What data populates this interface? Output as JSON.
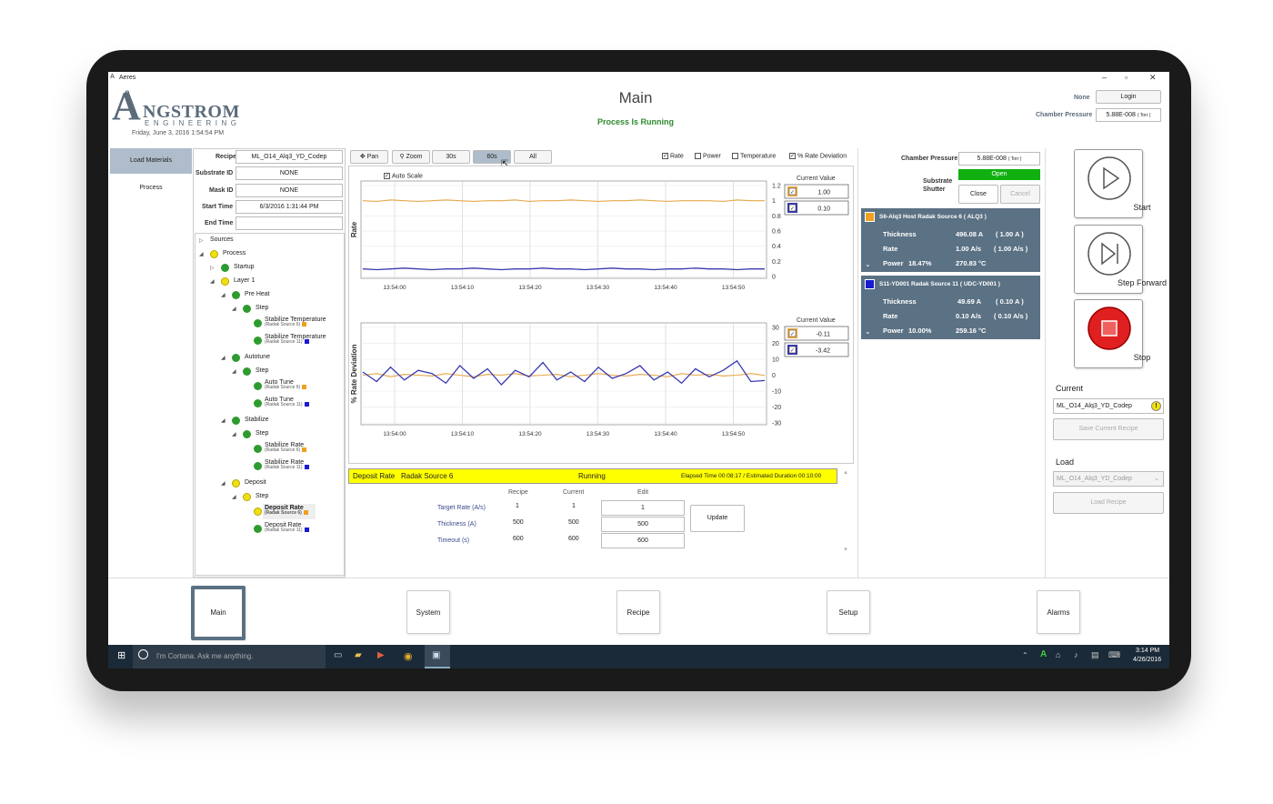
{
  "window": {
    "title": "Aeres"
  },
  "logo": {
    "initial": "A",
    "name": "NGSTROM",
    "sub": "ENGINEERING",
    "accent": "e"
  },
  "date_text": "Friday, June 3, 2016 1:54:54 PM",
  "header": {
    "title": "Main",
    "status": "Process Is Running",
    "user": "None",
    "login_label": "Login",
    "chamber_pressure_label": "Chamber Pressure",
    "chamber_pressure_value": "5.88E-008",
    "chamber_pressure_unit": "( Torr )"
  },
  "left_tabs": [
    "Load Materials",
    "Process"
  ],
  "info": {
    "recipe_label": "Recipe",
    "recipe_value": "ML_O14_Alq3_YD_Codep",
    "substrate_label": "Substrate ID",
    "substrate_value": "NONE",
    "mask_label": "Mask ID",
    "mask_value": "NONE",
    "start_label": "Start Time",
    "start_value": "6/3/2016 1:31:44 PM",
    "end_label": "End Time",
    "end_value": ""
  },
  "tree": {
    "sources": "Sources",
    "process": "Process",
    "startup": "Startup",
    "layer1": "Layer 1",
    "preheat": "Pre Heat",
    "step": "Step",
    "stab_temp": "Stabilize Temperature",
    "src6": "(Radak Source 6)",
    "src11": "(Radak Source 11)",
    "autotune": "Autotune",
    "auto_tune": "Auto Tune",
    "stabilize": "Stabilize",
    "stab_rate": "Stabilize Rate",
    "deposit": "Deposit",
    "dep_rate": "Deposit Rate"
  },
  "chart_toolbar": {
    "pan": "Pan",
    "zoom": "Zoom",
    "t30": "30s",
    "t60": "60s",
    "all": "All",
    "rate": "Rate",
    "power": "Power",
    "temperature": "Temperature",
    "rate_dev": "% Rate Deviation",
    "auto_scale": "Auto Scale"
  },
  "chart_data": [
    {
      "type": "line",
      "ylabel": "Rate",
      "ylim": [
        0,
        1.2
      ],
      "yticks": [
        "1.2",
        "1",
        "0.8",
        "0.6",
        "0.4",
        "0.2",
        "0"
      ],
      "xticks": [
        "13:54:00",
        "13:54:10",
        "13:54:20",
        "13:54:30",
        "13:54:40",
        "13:54:50"
      ],
      "legend_title": "Current Value",
      "series": [
        {
          "color": "#e8a94a",
          "current": "1.00",
          "values": [
            1.0,
            0.99,
            1.01,
            1.0,
            0.99,
            1.0,
            1.01,
            1.0,
            0.99,
            1.0,
            1.0,
            1.01,
            0.99,
            1.0,
            1.0,
            1.01,
            1.0,
            0.99,
            1.0,
            1.0,
            1.01,
            1.0,
            0.99,
            1.0,
            1.0,
            1.0,
            0.99,
            1.01,
            1.0,
            1.0
          ]
        },
        {
          "color": "#3a3ab0",
          "current": "0.10",
          "values": [
            0.1,
            0.09,
            0.1,
            0.11,
            0.1,
            0.09,
            0.1,
            0.1,
            0.11,
            0.1,
            0.09,
            0.1,
            0.1,
            0.11,
            0.1,
            0.1,
            0.09,
            0.1,
            0.11,
            0.1,
            0.1,
            0.09,
            0.1,
            0.1,
            0.11,
            0.1,
            0.1,
            0.09,
            0.1,
            0.1
          ]
        }
      ]
    },
    {
      "type": "line",
      "ylabel": "% Rate Deviation",
      "ylim": [
        -30,
        30
      ],
      "yticks": [
        "30",
        "20",
        "10",
        "0",
        "-10",
        "-20",
        "-30"
      ],
      "xticks": [
        "13:54:00",
        "13:54:10",
        "13:54:20",
        "13:54:30",
        "13:54:40",
        "13:54:50"
      ],
      "legend_title": "Current Value",
      "series": [
        {
          "color": "#e8a94a",
          "current": "-0.11",
          "values": [
            0,
            1,
            -1,
            0.5,
            0,
            -0.5,
            1,
            0,
            -1,
            0.5,
            0,
            1,
            -0.5,
            0,
            0.5,
            -1,
            0,
            1,
            0,
            -0.5,
            0.5,
            0,
            -1,
            1,
            0,
            0.5,
            -0.5,
            0,
            1,
            -0.1
          ]
        },
        {
          "color": "#3a3ab0",
          "current": "-3.42",
          "values": [
            2,
            -4,
            5,
            -3,
            3,
            1,
            -5,
            6,
            -2,
            4,
            -6,
            3,
            -1,
            8,
            -3,
            2,
            -4,
            5,
            -2,
            1,
            6,
            -3,
            2,
            -5,
            4,
            -1,
            3,
            9,
            -4,
            -3.4
          ]
        }
      ]
    }
  ],
  "step_bar": {
    "name": "Deposit Rate",
    "source": "Radak Source 6",
    "state": "Running",
    "elapsed": "Elapsed Time 00:08:17 / Estimated Duration 00:10:00"
  },
  "params": {
    "col_recipe": "Recipe",
    "col_current": "Current",
    "col_edit": "Edit",
    "rows": [
      {
        "label": "Target Rate (A/s)",
        "recipe": "1",
        "current": "1",
        "edit": "1"
      },
      {
        "label": "Thickness (A)",
        "recipe": "500",
        "current": "500",
        "edit": "500"
      },
      {
        "label": "Timeout (s)",
        "recipe": "600",
        "current": "600",
        "edit": "600"
      }
    ],
    "update": "Update"
  },
  "right": {
    "pressure_label": "Chamber Pressure",
    "pressure_value": "5.88E-008",
    "pressure_unit": "( Torr )",
    "shutter_label1": "Substrate",
    "shutter_label2": "Shutter",
    "shutter_state": "Open",
    "close": "Close",
    "cancel": "Cancel",
    "src1": {
      "title": "S6-Alq3 Host Radak Source 6 ( ALQ3 )",
      "color": "#f0a020",
      "thickness_label": "Thickness",
      "thickness": "496.08 A",
      "thickness_set": "( 1.00 A )",
      "rate_label": "Rate",
      "rate": "1.00 A/s",
      "rate_set": "( 1.00 A/s )",
      "power_label": "Power",
      "power": "18.47%",
      "temp": "270.83 °C"
    },
    "src2": {
      "title": "S11-YD001 Radak Source 11 ( UDC-YD001 )",
      "color": "#1a1ad0",
      "thickness_label": "Thickness",
      "thickness": "49.69 A",
      "thickness_set": "( 0.10 A )",
      "rate_label": "Rate",
      "rate": "0.10 A/s",
      "rate_set": "( 0.10 A/s )",
      "power_label": "Power",
      "power": "10.00%",
      "temp": "259.16 °C"
    }
  },
  "controls": {
    "start": "Start",
    "step_forward": "Step Forward",
    "stop": "Stop",
    "current_label": "Current",
    "current_recipe": "ML_O14_Alq3_YD_Codep",
    "save": "Save Current Recipe",
    "load_label": "Load",
    "load_recipe": "ML_O14_Alq3_YD_Codep",
    "load_btn": "Load Recipe"
  },
  "nav": [
    "Main",
    "System",
    "Recipe",
    "Setup",
    "Alarms"
  ],
  "taskbar": {
    "search": "I'm Cortana. Ask me anything.",
    "time": "3:14 PM",
    "date": "4/26/2016"
  }
}
